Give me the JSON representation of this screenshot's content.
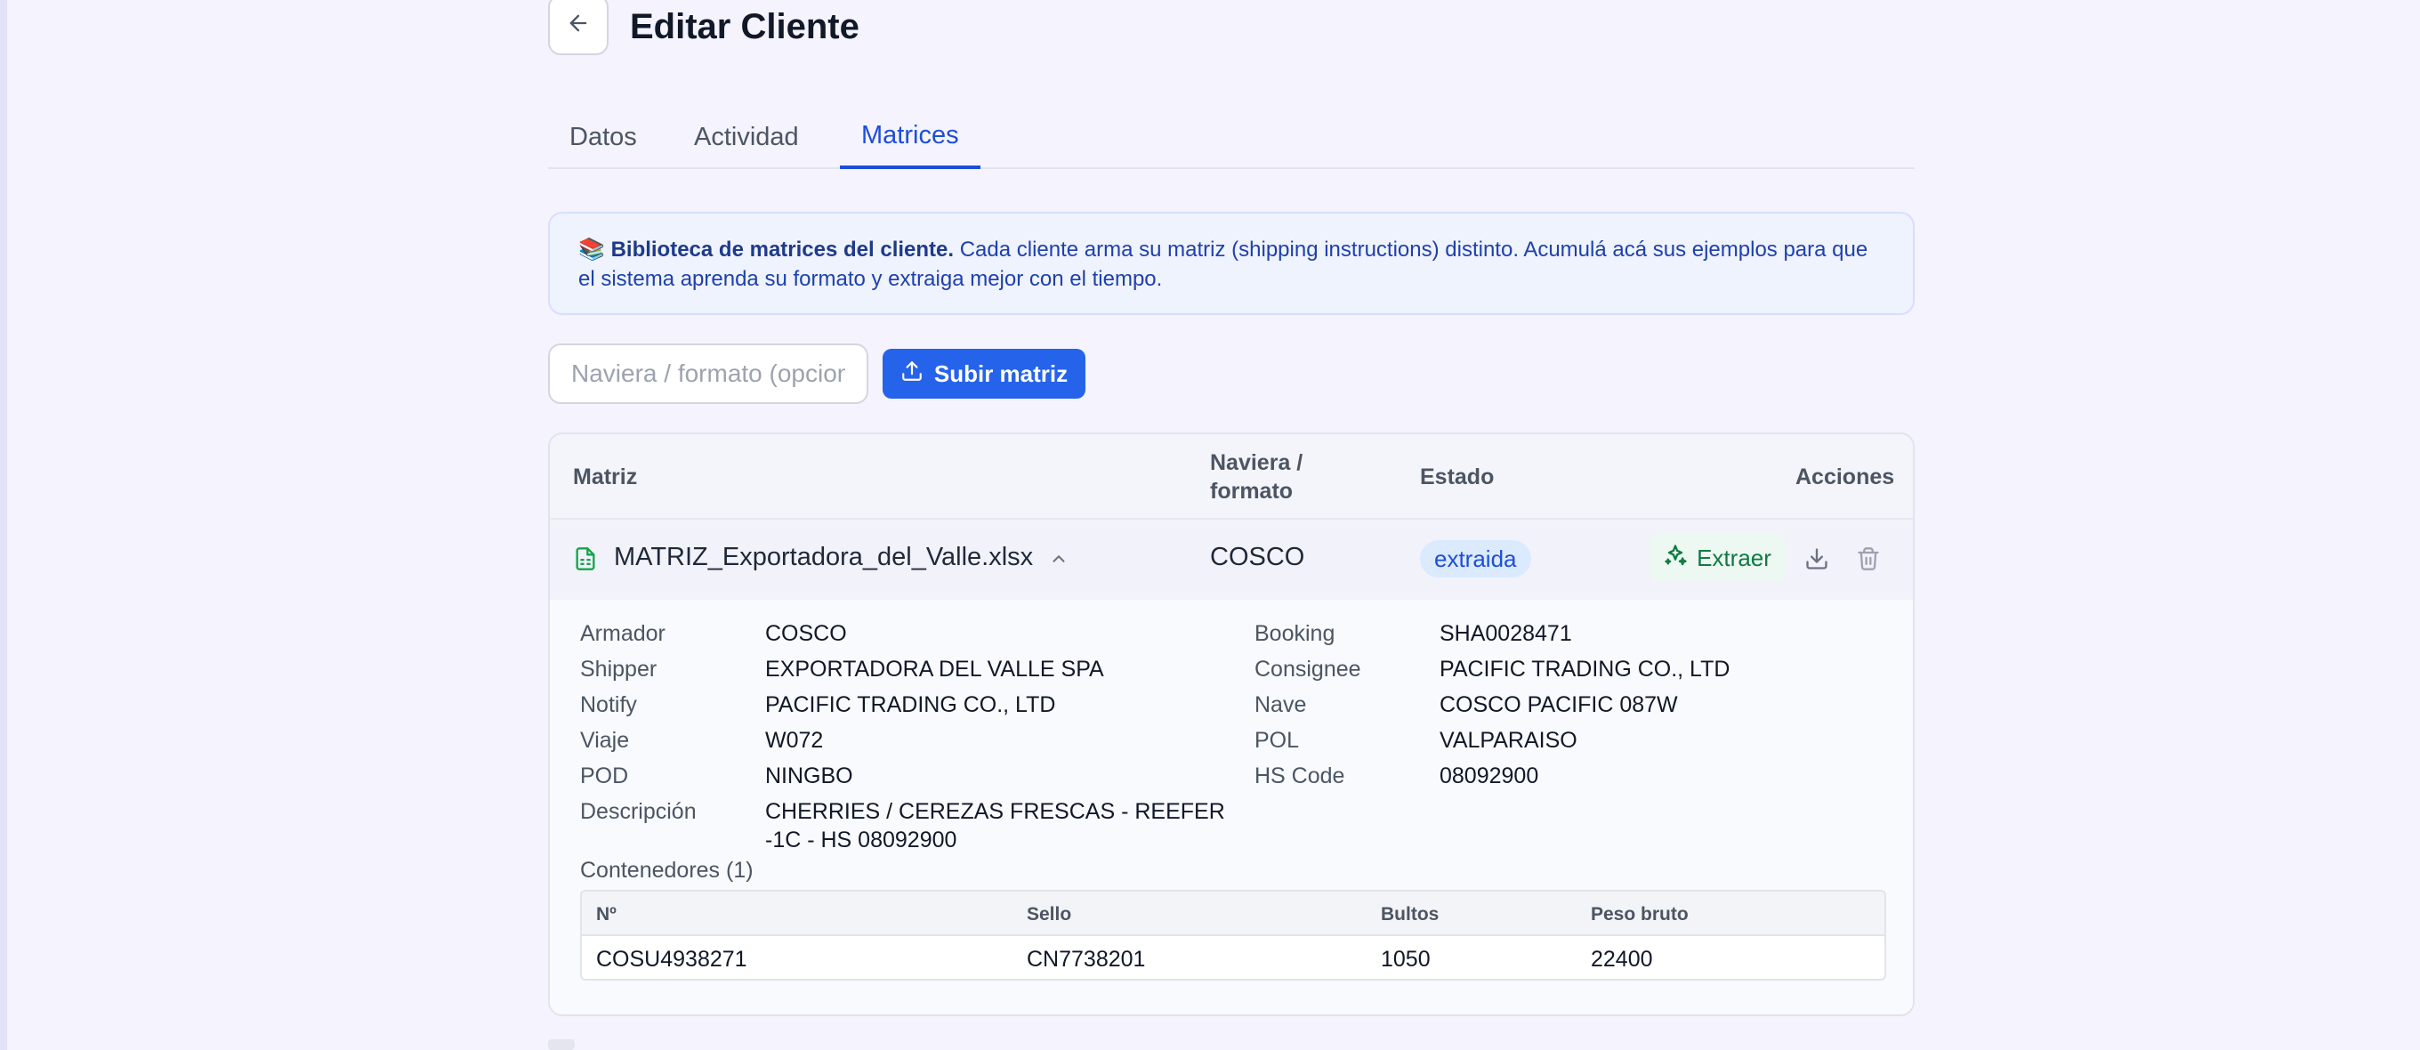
{
  "header": {
    "title": "Editar Cliente"
  },
  "tabs": [
    {
      "label": "Datos",
      "active": false
    },
    {
      "label": "Actividad",
      "active": false
    },
    {
      "label": "Matrices",
      "active": true
    }
  ],
  "banner": {
    "emoji": "📚",
    "bold": "Biblioteca de matrices del cliente.",
    "text": " Cada cliente arma su matriz (shipping instructions) distinto. Acumulá acá sus ejemplos para que el sistema aprenda su formato y extraiga mejor con el tiempo."
  },
  "upload": {
    "placeholder": "Naviera / formato (opcional)",
    "button_label": "Subir matriz"
  },
  "table": {
    "headers": {
      "matriz": "Matriz",
      "naviera_1": "Naviera /",
      "naviera_2": "formato",
      "estado": "Estado",
      "acciones": "Acciones"
    },
    "row": {
      "file_name": "MATRIZ_Exportadora_del_Valle.xlsx",
      "naviera": "COSCO",
      "estado": "extraida",
      "extract_label": "Extraer"
    }
  },
  "detail": {
    "left": [
      {
        "k": "Armador",
        "v": "COSCO"
      },
      {
        "k": "Shipper",
        "v": "EXPORTADORA DEL VALLE SPA"
      },
      {
        "k": "Notify",
        "v": "PACIFIC TRADING CO., LTD"
      },
      {
        "k": "Viaje",
        "v": "W072"
      },
      {
        "k": "POD",
        "v": "NINGBO"
      },
      {
        "k": "Descripción",
        "v1": "CHERRIES / CEREZAS FRESCAS - REEFER",
        "v2": "-1C - HS 08092900"
      }
    ],
    "right": [
      {
        "k": "Booking",
        "v": "SHA0028471"
      },
      {
        "k": "Consignee",
        "v": "PACIFIC TRADING CO., LTD"
      },
      {
        "k": "Nave",
        "v": "COSCO PACIFIC 087W"
      },
      {
        "k": "POL",
        "v": "VALPARAISO"
      },
      {
        "k": "HS Code",
        "v": "08092900"
      }
    ],
    "containers_title": "Contenedores (1)",
    "containers_headers": {
      "n": "Nº",
      "sello": "Sello",
      "bultos": "Bultos",
      "peso": "Peso bruto"
    },
    "containers": [
      {
        "n": "COSU4938271",
        "sello": "CN7738201",
        "bultos": "1050",
        "peso": "22400"
      }
    ]
  },
  "colors": {
    "accent": "#2563eb",
    "success": "#0f7a43",
    "badge_bg": "#dbeafe"
  }
}
